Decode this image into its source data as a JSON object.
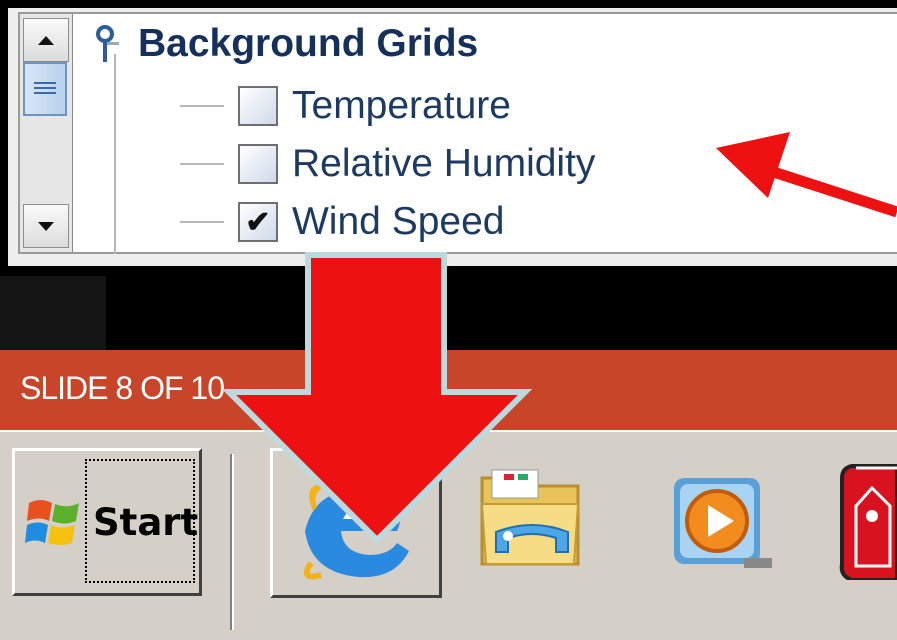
{
  "tree": {
    "root_label": "Background Grids",
    "items": [
      {
        "label": "Temperature",
        "checked": false
      },
      {
        "label": "Relative Humidity",
        "checked": false
      },
      {
        "label": "Wind Speed",
        "checked": true
      }
    ],
    "check_glyph": "✔"
  },
  "slide_bar": {
    "text": "SLIDE 8 OF 10"
  },
  "taskbar": {
    "start_label": "Start",
    "quick_launch": [
      "ie-icon",
      "explorer-folder-icon",
      "media-player-icon",
      "red-app-icon"
    ]
  },
  "annotations": {
    "arrow_color": "#ee1111"
  }
}
